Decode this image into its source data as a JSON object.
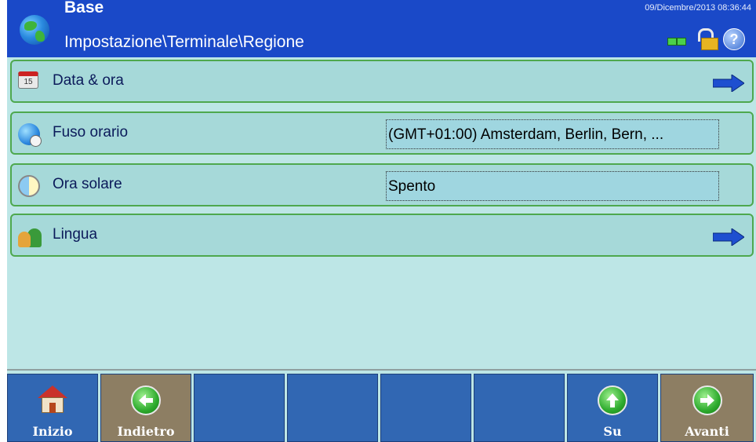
{
  "header": {
    "title": "Base",
    "path": "Impostazione\\Terminale\\Regione",
    "datetime": "09/Dicembre/2013 08:36:44",
    "icons": [
      "globe-icon",
      "network-icon",
      "unlocked-icon",
      "help-icon"
    ],
    "bg_color": "#1a49c8"
  },
  "rows": [
    {
      "label": "Data & ora",
      "icon": "calendar-icon",
      "has_arrow": true
    },
    {
      "label": "Fuso orario",
      "icon": "timezone-globe-icon",
      "value": "(GMT+01:00) Amsterdam, Berlin, Bern, ..."
    },
    {
      "label": "Ora solare",
      "icon": "daylight-saving-icon",
      "value": "Spento"
    },
    {
      "label": "Lingua",
      "icon": "language-people-icon",
      "has_arrow": true
    }
  ],
  "softkeys": [
    {
      "label": "Inizio",
      "icon": "home-icon",
      "color": "#3167b3"
    },
    {
      "label": "Indietro",
      "icon": "back-arrow-icon",
      "color": "#8d7e63"
    },
    {
      "label": "",
      "color": "#3167b3"
    },
    {
      "label": "",
      "color": "#3167b3"
    },
    {
      "label": "",
      "color": "#3167b3"
    },
    {
      "label": "",
      "color": "#3167b3"
    },
    {
      "label": "Su",
      "icon": "up-arrow-icon",
      "color": "#3167b3"
    },
    {
      "label": "Avanti",
      "icon": "forward-arrow-icon",
      "color": "#8d7e63"
    }
  ],
  "colors": {
    "content_bg": "#bde6e6",
    "row_bg": "#a6d9d9",
    "row_border": "#4ea84e"
  }
}
